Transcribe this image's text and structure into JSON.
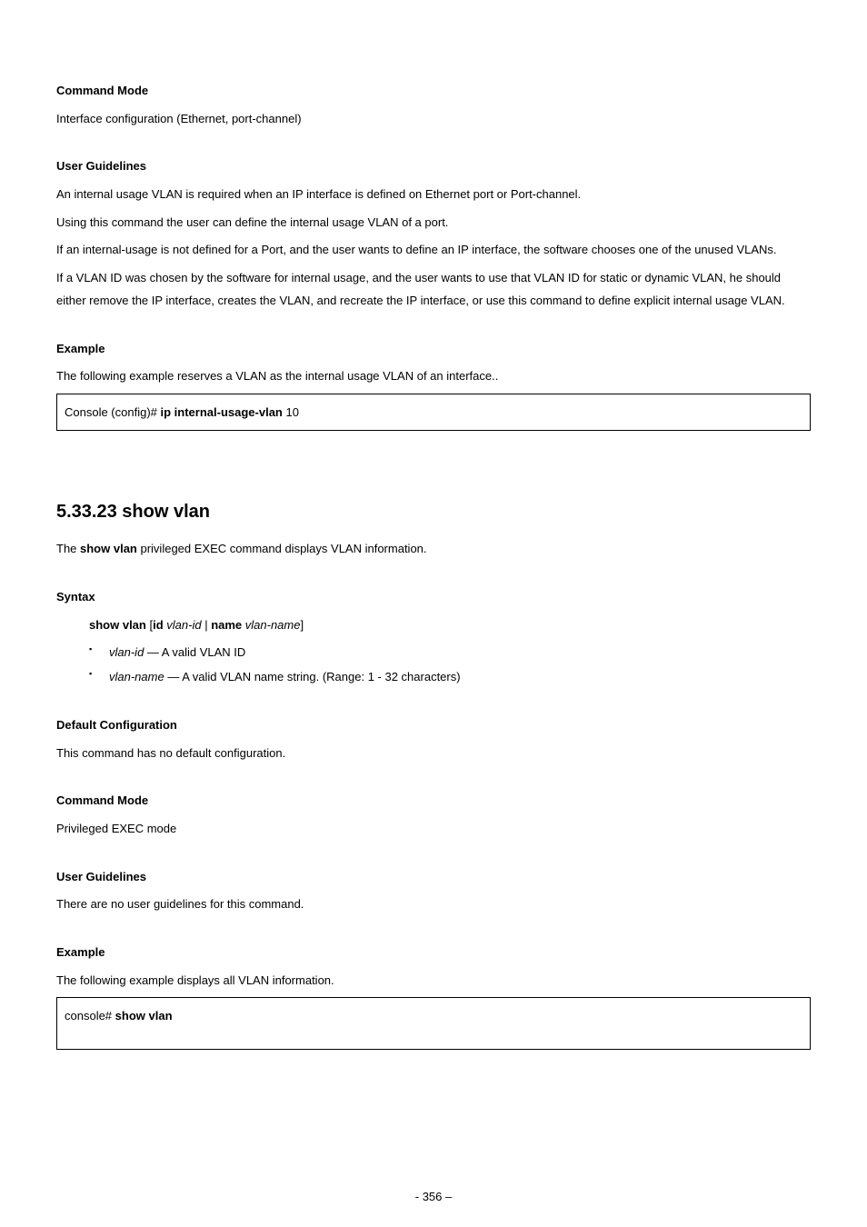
{
  "headings": {
    "command_mode": "Command Mode",
    "user_guidelines": "User Guidelines",
    "example": "Example",
    "syntax": "Syntax",
    "default_config": "Default Configuration"
  },
  "block1": {
    "cmd_mode_text": "Interface configuration (Ethernet, port-channel)",
    "ug_p1": "An internal usage VLAN is required when an IP interface is defined on Ethernet port or Port-channel.",
    "ug_p2": "Using this command the user can define the internal usage VLAN of a port.",
    "ug_p3": "If an internal-usage is not defined for a Port, and the user wants to define an IP interface, the software chooses one of the unused VLANs.",
    "ug_p4": "If a VLAN ID was chosen by the software for internal usage, and the user wants to use that VLAN ID for static or dynamic VLAN, he should either remove the IP interface, creates the VLAN, and recreate the IP interface, or use this command to define explicit internal usage VLAN.",
    "example_intro": "The following example reserves a VLAN as the internal usage VLAN of an interface..",
    "code_prefix": "Console (config)# ",
    "code_cmd_bold": "ip internal-usage-vlan",
    "code_arg": " 10"
  },
  "block2": {
    "title": "5.33.23 show vlan",
    "desc_pre": "The ",
    "desc_bold": "show vlan",
    "desc_post": " privileged EXEC command displays VLAN information.",
    "syntax_line_b1": "show vlan ",
    "syntax_line_txt1": "[",
    "syntax_line_b2": "id",
    "syntax_line_i1": " vlan-id ",
    "syntax_line_txt2": "| ",
    "syntax_line_b3": "name",
    "syntax_line_i2": " vlan-name",
    "syntax_line_txt3": "]",
    "bullet1_i": "vlan-id",
    "bullet1_txt": " — A valid VLAN ID",
    "bullet2_i": "vlan-name",
    "bullet2_txt": " — A valid VLAN name string. (Range: 1 - 32 characters)",
    "default_cfg_text": "This command has no default configuration.",
    "cmd_mode_text": "Privileged EXEC mode",
    "ug_text": "There are no user guidelines for this command.",
    "example_intro": "The following example displays all VLAN information.",
    "code_prefix": "console# ",
    "code_cmd_bold": "show vlan"
  },
  "page_number": "- 356 –"
}
